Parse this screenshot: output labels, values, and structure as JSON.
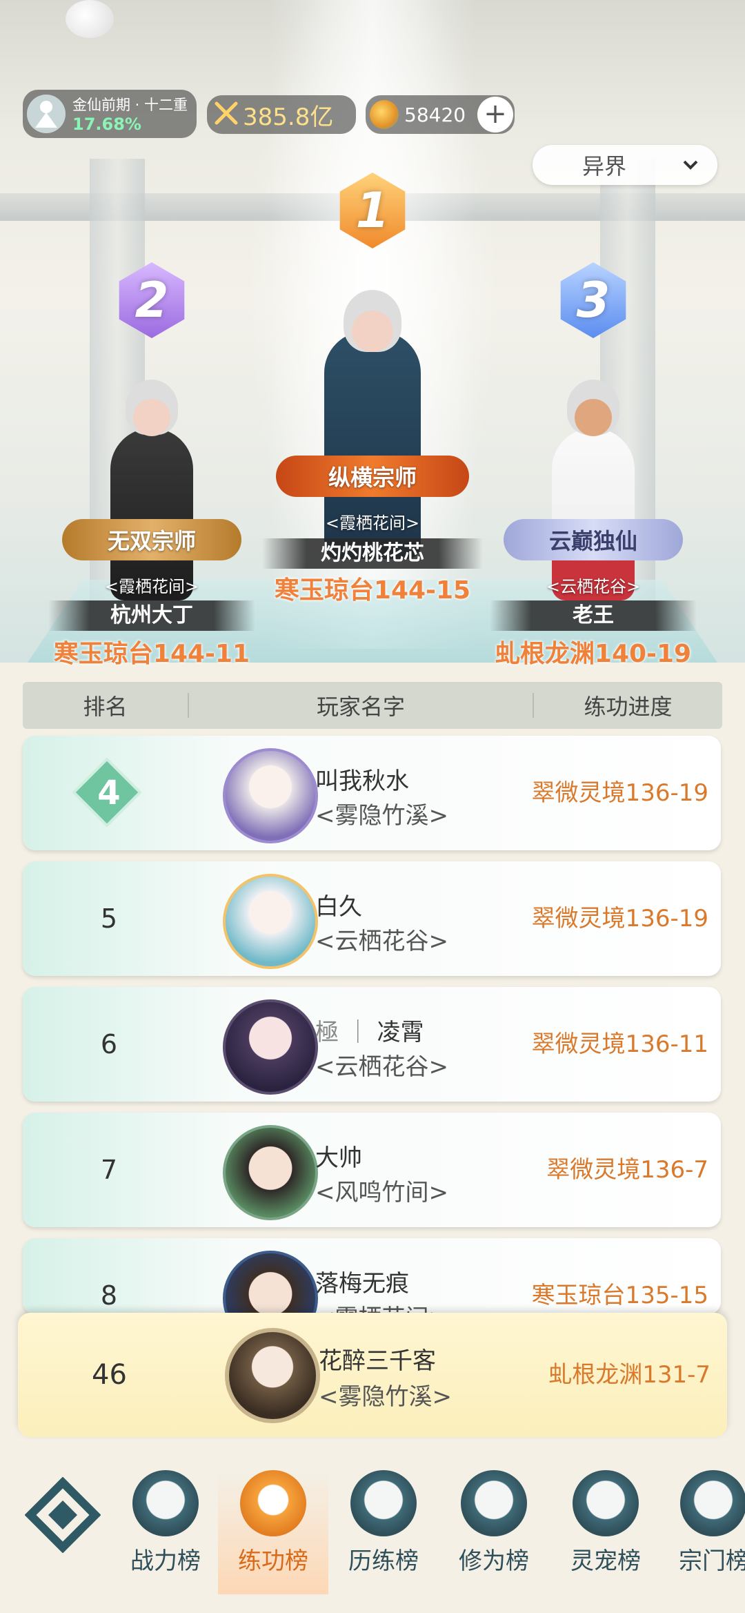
{
  "header": {
    "realm_name": "金仙前期 · 十二重",
    "realm_percent": "17.68%",
    "power_value": "385.8亿",
    "currency_value": "58420",
    "plus_label": "+",
    "server_dropdown": "异界"
  },
  "podium": {
    "first": {
      "rank": "1",
      "title": "纵横宗师",
      "sect": "<霞栖花间>",
      "name": "灼灼桃花芯",
      "progress": "寒玉琼台144-15"
    },
    "second": {
      "rank": "2",
      "title": "无双宗师",
      "sect": "<霞栖花间>",
      "name": "杭州大丁",
      "progress": "寒玉琼台144-11"
    },
    "third": {
      "rank": "3",
      "title": "云巅独仙",
      "sect": "<云栖花谷>",
      "name": "老王",
      "progress": "虬根龙渊140-19"
    }
  },
  "table": {
    "headers": [
      "排名",
      "玩家名字",
      "练功进度"
    ],
    "rows": [
      {
        "rank": "4",
        "name": "叫我秋水",
        "sect": "<雾隐竹溪>",
        "progress": "翠微灵境136-19"
      },
      {
        "rank": "5",
        "name": "白久",
        "sect": "<云栖花谷>",
        "progress": "翠微灵境136-19"
      },
      {
        "rank": "6",
        "name_prefix": "極 ｜",
        "name": "凌霄",
        "sect": "<云栖花谷>",
        "progress": "翠微灵境136-11"
      },
      {
        "rank": "7",
        "name": "大帅",
        "sect": "<风鸣竹间>",
        "progress": "翠微灵境136-7"
      },
      {
        "rank": "8",
        "name": "落梅无痕",
        "sect": "<霞栖花间>",
        "progress": "寒玉琼台135-15"
      }
    ],
    "self_row": {
      "rank": "46",
      "name": "花醉三千客",
      "sect": "<雾隐竹溪>",
      "progress": "虬根龙渊131-7"
    }
  },
  "nav": {
    "items": [
      {
        "label": "战力榜",
        "icon": "sword-icon"
      },
      {
        "label": "练功榜",
        "icon": "yin-yang-icon",
        "active": true
      },
      {
        "label": "历练榜",
        "icon": "star-icon"
      },
      {
        "label": "修为榜",
        "icon": "book-icon"
      },
      {
        "label": "灵宠榜",
        "icon": "pet-icon"
      },
      {
        "label": "宗门榜",
        "icon": "scroll-icon"
      }
    ]
  },
  "colors": {
    "accent_orange": "#d9792c",
    "rank1": "#f08a2c",
    "rank2": "#9b6be0",
    "rank3": "#5b8df0"
  }
}
